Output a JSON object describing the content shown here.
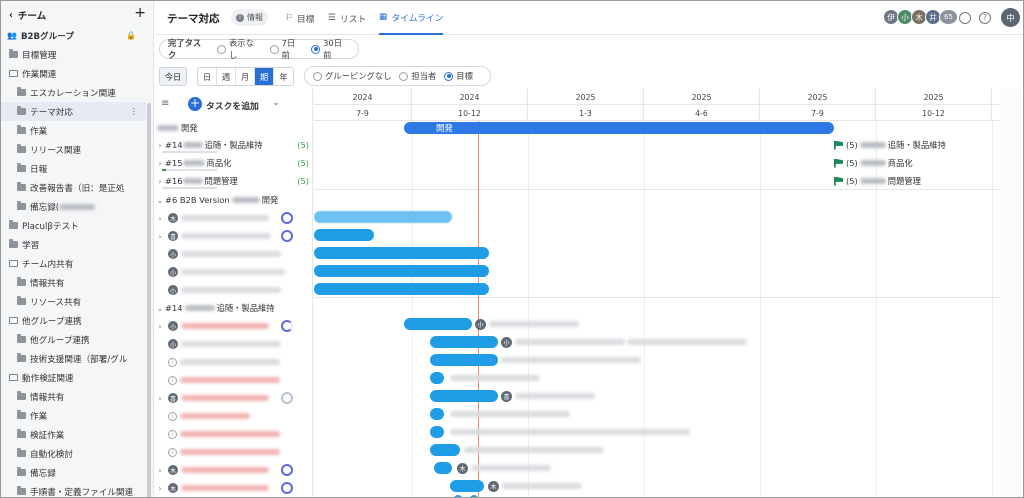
{
  "sidebar": {
    "header": "チーム",
    "add_symbol": "+",
    "group": "B2Bグループ",
    "items": [
      {
        "label": "目標管理",
        "icon": "folder-icon"
      },
      {
        "label": "作業関連",
        "icon": "multi-folder-icon"
      },
      {
        "label": "エスカレーション関連",
        "icon": "folder-icon"
      },
      {
        "label": "テーマ対応",
        "icon": "folder-icon"
      },
      {
        "label": "作業",
        "icon": "folder-icon"
      },
      {
        "label": "リリース関連",
        "icon": "folder-icon"
      },
      {
        "label": "日報",
        "icon": "folder-icon"
      },
      {
        "label": "改善報告書（旧：是正処",
        "icon": "folder-icon"
      },
      {
        "label": "備忘録(",
        "icon": "folder-icon"
      },
      {
        "label": "Placulβテスト",
        "icon": "folder-icon"
      },
      {
        "label": "学習",
        "icon": "folder-icon"
      },
      {
        "label": "チーム内共有",
        "icon": "multi-folder-icon"
      },
      {
        "label": "情報共有",
        "icon": "folder-icon"
      },
      {
        "label": "リソース共有",
        "icon": "folder-icon"
      },
      {
        "label": "他グループ連携",
        "icon": "multi-folder-icon"
      },
      {
        "label": "他グループ連携",
        "icon": "folder-icon"
      },
      {
        "label": "技術支援関連（部署/グル",
        "icon": "folder-icon"
      },
      {
        "label": "動作検証関連",
        "icon": "multi-folder-icon"
      },
      {
        "label": "情報共有",
        "icon": "folder-icon"
      },
      {
        "label": "作業",
        "icon": "folder-icon"
      },
      {
        "label": "検証作業",
        "icon": "folder-icon"
      },
      {
        "label": "自動化検討",
        "icon": "folder-icon"
      },
      {
        "label": "備忘録",
        "icon": "folder-icon"
      },
      {
        "label": "手順書・定義ファイル関連",
        "icon": "folder-icon"
      }
    ]
  },
  "topbar": {
    "title": "テーマ対応",
    "info": "情報",
    "tabs": [
      {
        "label": "目標"
      },
      {
        "label": "リスト"
      },
      {
        "label": "タイムライン",
        "active": true
      }
    ],
    "avatars": [
      "伊",
      "小",
      "木",
      "井",
      "65"
    ],
    "me": "中"
  },
  "filters": {
    "completed_label": "完了タスク",
    "completed_options": [
      "表示なし",
      "7日前",
      "30日前"
    ],
    "completed_selected": "30日前",
    "today": "今日",
    "scale": [
      "日",
      "週",
      "月",
      "期",
      "年"
    ],
    "scale_selected": "期",
    "grouping": [
      "グルーピングなし",
      "担当者",
      "目標"
    ],
    "grouping_selected": "目標"
  },
  "list": {
    "add_task": "タスクを追加",
    "rows": {
      "dev": "開発",
      "g14": "#14",
      "g14_label": "追随・製品維持",
      "g15": "#15",
      "g15_label": "商品化",
      "g16": "#16",
      "g16_label": "問題管理",
      "count": "(5)",
      "sec6": "#6 B2B Version",
      "sec6_tail": "開発",
      "sec14": "#14",
      "sec14_tail": "追随・製品維持"
    },
    "avatars": {
      "a": "木",
      "b": "喜",
      "c": "小",
      "d": "井"
    }
  },
  "timeline": {
    "years": [
      "2024",
      "2024",
      "2025",
      "2025",
      "2025",
      "2025"
    ],
    "quarters": [
      "7-9",
      "10-12",
      "1-3",
      "4-6",
      "7-9",
      "10-12"
    ],
    "dev_bar": "開発",
    "g14_label": "追随・製品維持",
    "g15_label": "商品化",
    "g16_label": "問題管理",
    "count": "(5)"
  },
  "colors": {
    "accent": "#2a6fd6",
    "bar": "#1e9ce6",
    "today_line": "#ef8a6a",
    "flag": "#1b8a5a"
  }
}
